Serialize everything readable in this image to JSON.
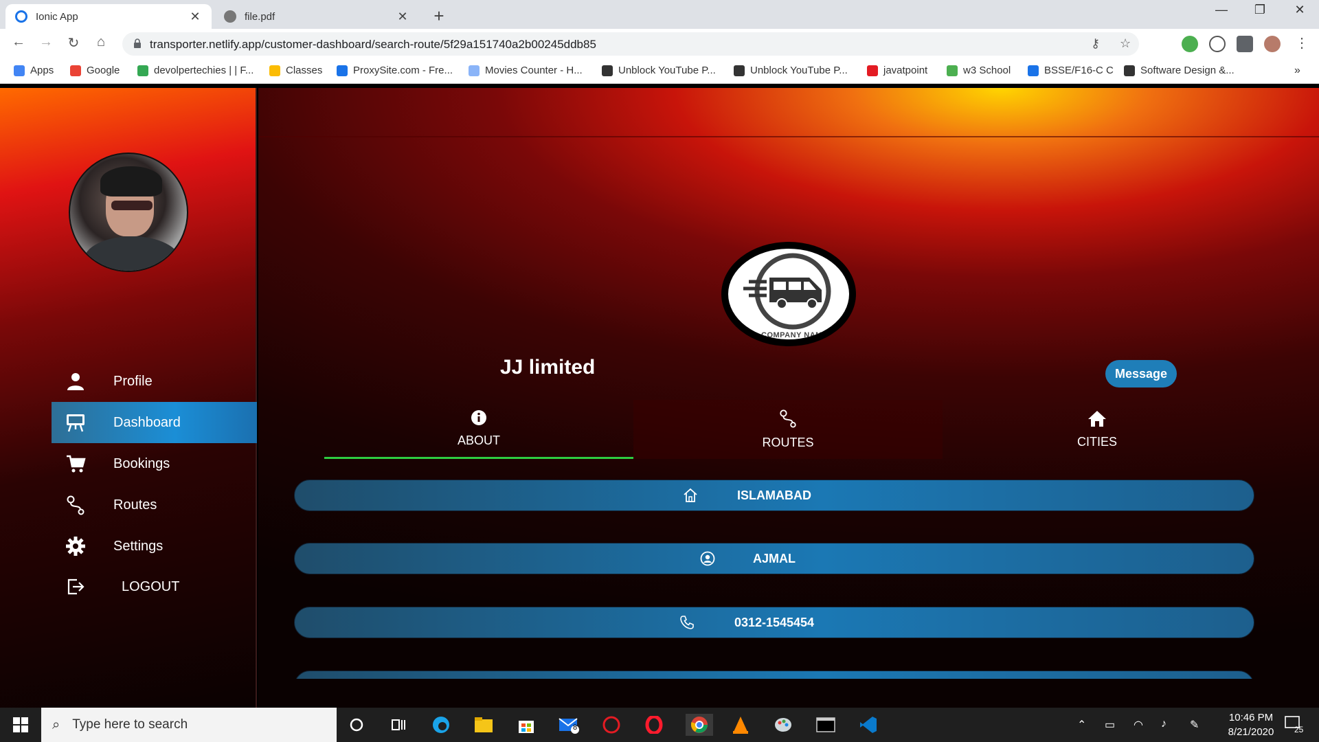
{
  "browser": {
    "tabs": [
      {
        "title": "Ionic App",
        "active": true
      },
      {
        "title": "file.pdf",
        "active": false
      }
    ],
    "url": "transporter.netlify.app/customer-dashboard/search-route/5f29a151740a2b00245ddb85",
    "bookmarks": [
      {
        "label": "Apps",
        "color": "#4285f4"
      },
      {
        "label": "Google",
        "color": "#ea4335"
      },
      {
        "label": "devolpertechies | | F...",
        "color": "#34a853"
      },
      {
        "label": "Classes",
        "color": "#fbbc04"
      },
      {
        "label": "ProxySite.com - Fre...",
        "color": "#1a73e8"
      },
      {
        "label": "Movies Counter - H...",
        "color": "#8ab4f8"
      },
      {
        "label": "Unblock YouTube P...",
        "color": "#333333"
      },
      {
        "label": "Unblock YouTube P...",
        "color": "#333333"
      },
      {
        "label": "javatpoint",
        "color": "#e31b23"
      },
      {
        "label": "w3 School",
        "color": "#4caf50"
      },
      {
        "label": "BSSE/F16-C C",
        "color": "#1a73e8"
      },
      {
        "label": "Software Design &...",
        "color": "#333333"
      }
    ],
    "more_bookmarks": "»"
  },
  "sidebar": {
    "items": [
      {
        "label": "Profile",
        "icon": "person-icon"
      },
      {
        "label": "Dashboard",
        "icon": "easel-icon",
        "active": true
      },
      {
        "label": "Bookings",
        "icon": "cart-icon"
      },
      {
        "label": "Routes",
        "icon": "route-icon"
      },
      {
        "label": "Settings",
        "icon": "gear-icon"
      },
      {
        "label": "LOGOUT",
        "icon": "logout-icon"
      }
    ]
  },
  "company": {
    "name": "JJ limited",
    "logo_text": "COMPANY NAME",
    "message_label": "Message"
  },
  "tabs": [
    {
      "label": "ABOUT",
      "icon": "info-icon",
      "selected": true
    },
    {
      "label": "ROUTES",
      "icon": "route-icon",
      "selected": false
    },
    {
      "label": "CITIES",
      "icon": "home-icon",
      "selected": false
    }
  ],
  "about": {
    "city": "ISLAMABAD",
    "owner": "AJMAL",
    "phone": "0312-1545454"
  },
  "taskbar": {
    "search_placeholder": "Type here to search",
    "time": "10:46 PM",
    "date": "8/21/2020",
    "mail_badge": "8",
    "notifications": "25"
  },
  "colors": {
    "accent_blue": "#1b8ed6",
    "tab_indicator": "#2ecc40"
  }
}
